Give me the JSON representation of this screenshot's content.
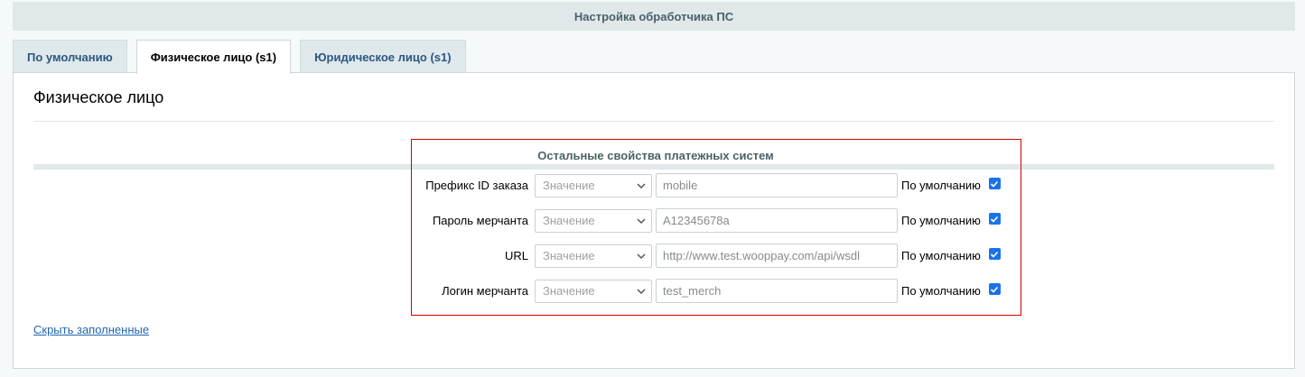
{
  "header": {
    "title": "Настройка обработчика ПС"
  },
  "tabs": [
    {
      "label": "По умолчанию"
    },
    {
      "label": "Физическое лицо (s1)"
    },
    {
      "label": "Юридическое лицо (s1)"
    }
  ],
  "panel": {
    "title": "Физическое лицо",
    "group_title": "Остальные свойства платежных систем",
    "hide_link": "Скрыть заполненные"
  },
  "props": [
    {
      "label": "Префикс ID заказа",
      "select": "Значение",
      "value": "mobile",
      "default_label": "По умолчанию",
      "checked": true
    },
    {
      "label": "Пароль мерчанта",
      "select": "Значение",
      "value": "A12345678a",
      "default_label": "По умолчанию",
      "checked": true
    },
    {
      "label": "URL",
      "select": "Значение",
      "value": "http://www.test.wooppay.com/api/wsdl",
      "default_label": "По умолчанию",
      "checked": true
    },
    {
      "label": "Логин мерчанта",
      "select": "Значение",
      "value": "test_merch",
      "default_label": "По умолчанию",
      "checked": true
    }
  ],
  "colors": {
    "accent_checkbox": "#1a73e8",
    "link": "#2067b0",
    "highlight_border": "#d40000"
  }
}
